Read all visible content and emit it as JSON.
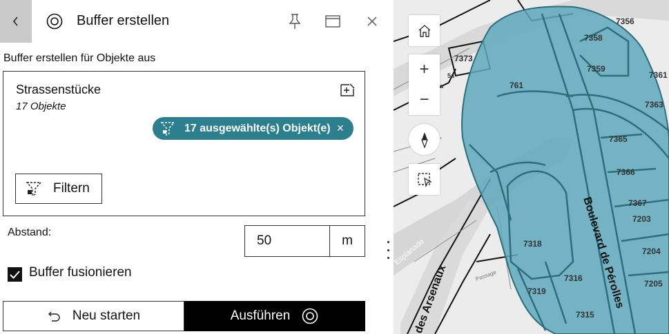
{
  "header": {
    "title": "Buffer erstellen",
    "back_icon": "chevron-left-icon",
    "tool_icon": "buffer-icon",
    "pin_icon": "pin-icon",
    "window_icon": "window-icon",
    "close_icon": "close-icon"
  },
  "source": {
    "subtitle": "Buffer erstellen für Objekte aus",
    "layer_name": "Strassenstücke",
    "object_count": "17 Objekte",
    "selection_chip": "17 ausgewählte(s) Objekt(e)",
    "selection_chip_close": "×",
    "filter_button": "Filtern"
  },
  "distance": {
    "label": "Abstand:",
    "value": "50",
    "unit": "m"
  },
  "options": {
    "merge_label": "Buffer fusionieren",
    "merge_checked": true
  },
  "actions": {
    "restart_label": "Neu starten",
    "run_label": "Ausführen"
  },
  "map": {
    "zoom_in": "+",
    "zoom_out": "−",
    "street_labels": [
      "Boulevard de Pérolles",
      "des Arsenaux",
      "Esplanade",
      "Passage"
    ],
    "parcel_labels": [
      "7358",
      "7356",
      "7359",
      "7361",
      "7363",
      "7365",
      "7366",
      "7367",
      "7203",
      "7204",
      "7205",
      "7318",
      "7316",
      "7319",
      "7315",
      "7373",
      "761",
      "5a",
      "3a"
    ]
  },
  "colors": {
    "accent": "#2c7f8e",
    "buffer_fill": "#5ea9bd",
    "primary_button": "#000000",
    "back_button": "#c9c9c9"
  }
}
